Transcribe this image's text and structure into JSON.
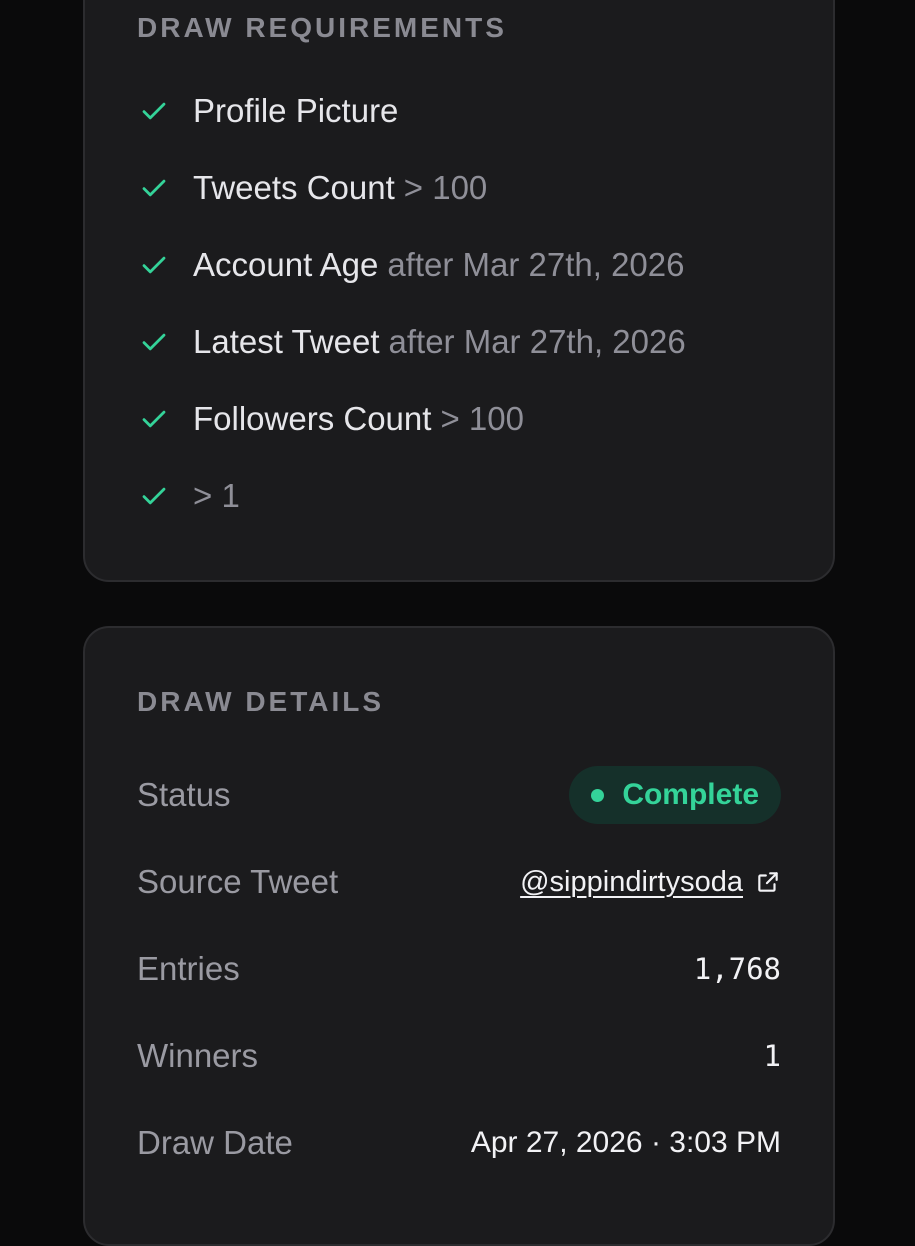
{
  "requirements": {
    "title": "DRAW REQUIREMENTS",
    "items": [
      {
        "label": "Profile Picture",
        "condition": "",
        "icon": "check-icon"
      },
      {
        "label": "Tweets Count",
        "condition": "> 100",
        "icon": "check-icon"
      },
      {
        "label": "Account Age",
        "condition": "after Mar 27th, 2026",
        "icon": "check-icon"
      },
      {
        "label": "Latest Tweet",
        "condition": "after Mar 27th, 2026",
        "icon": "check-icon"
      },
      {
        "label": "Followers Count",
        "condition": "> 100",
        "icon": "check-icon"
      },
      {
        "label": "",
        "condition": "> 1",
        "icon": "check-icon"
      }
    ]
  },
  "details": {
    "title": "DRAW DETAILS",
    "status_label": "Status",
    "status_value": "Complete",
    "source_label": "Source Tweet",
    "source_value": "@sippindirtysoda",
    "source_icon": "external-link-icon",
    "entries_label": "Entries",
    "entries_value": "1,768",
    "winners_label": "Winners",
    "winners_value": "1",
    "date_label": "Draw Date",
    "date_value": "Apr 27, 2026 · 3:03 PM"
  },
  "colors": {
    "background": "#0a0a0b",
    "card": "#1b1b1d",
    "check": "#34d399",
    "status_bg": "#15302a"
  }
}
